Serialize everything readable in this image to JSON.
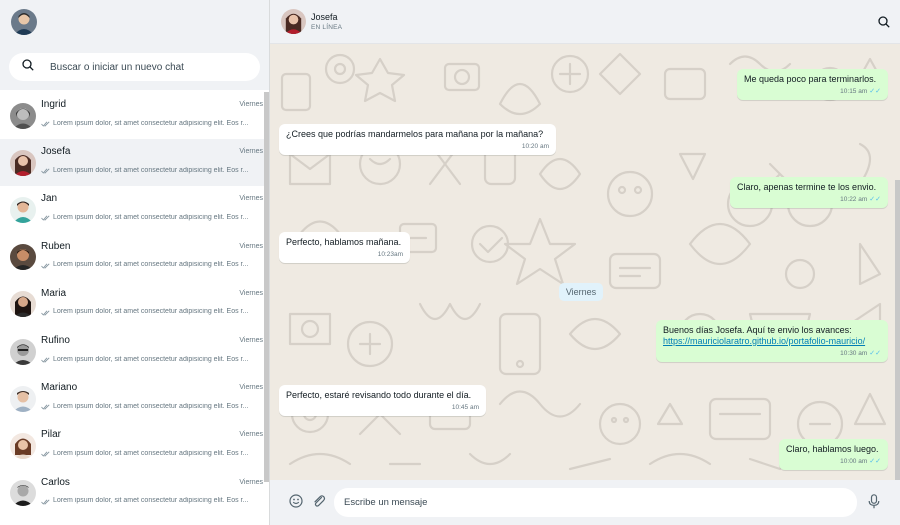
{
  "sidebar": {
    "search_placeholder": "Buscar o iniciar un nuevo chat",
    "chats": [
      {
        "name": "Ingrid",
        "time": "Viernes",
        "preview": "Lorem ipsum dolor, sit amet consectetur adipisicing elit. Eos r..."
      },
      {
        "name": "Josefa",
        "time": "Viernes",
        "preview": "Lorem ipsum dolor, sit amet consectetur adipisicing elit. Eos r..."
      },
      {
        "name": "Jan",
        "time": "Viernes",
        "preview": "Lorem ipsum dolor, sit amet consectetur adipisicing elit. Eos r..."
      },
      {
        "name": "Ruben",
        "time": "Viernes",
        "preview": "Lorem ipsum dolor, sit amet consectetur adipisicing elit. Eos r..."
      },
      {
        "name": "Maria",
        "time": "Viernes",
        "preview": "Lorem ipsum dolor, sit amet consectetur adipisicing elit. Eos r..."
      },
      {
        "name": "Rufino",
        "time": "Viernes",
        "preview": "Lorem ipsum dolor, sit amet consectetur adipisicing elit. Eos r..."
      },
      {
        "name": "Mariano",
        "time": "Viernes",
        "preview": "Lorem ipsum dolor, sit amet consectetur adipisicing elit. Eos r..."
      },
      {
        "name": "Pilar",
        "time": "Viernes",
        "preview": "Lorem ipsum dolor, sit amet consectetur adipisicing elit. Eos r..."
      },
      {
        "name": "Carlos",
        "time": "Viernes",
        "preview": "Lorem ipsum dolor, sit amet consectetur adipisicing elit. Eos r..."
      }
    ]
  },
  "chat": {
    "contact_name": "Josefa",
    "contact_status": "EN LÍNEA",
    "date_divider": "Viernes",
    "messages": [
      {
        "text": "Me queda poco para terminarlos.",
        "time": "10:15 am"
      },
      {
        "text": "¿Crees que podrías mandarmelos para mañana por la mañana?",
        "time": "10:20 am"
      },
      {
        "text": "Claro, apenas termine te los envio.",
        "time": "10:22 am"
      },
      {
        "text": "Perfecto, hablamos mañana.",
        "time": "10:23am"
      },
      {
        "text": "Buenos días Josefa. Aquí te envio los avances:",
        "link": "https://mauriciolaratro.github.io/portafolio-mauricio/",
        "time": "10:30 am"
      },
      {
        "text": "Perfecto, estaré revisando todo durante el día.",
        "time": "10:45 am"
      },
      {
        "text": "Claro, hablamos luego.",
        "time": "10:00 am"
      }
    ],
    "composer_placeholder": "Escribe un mensaje"
  },
  "icons": {
    "header_search": "search-icon",
    "emoji": "emoji-icon",
    "attach": "paperclip-icon",
    "mic": "microphone-icon",
    "read_receipt": "double-check-icon"
  },
  "colors": {
    "panel_bg": "#f0f2f5",
    "chat_bg": "#efeae2",
    "outgoing_bubble": "#d9fdd3",
    "incoming_bubble": "#ffffff",
    "read_ticks": "#53bdeb",
    "link": "#027eb5"
  }
}
